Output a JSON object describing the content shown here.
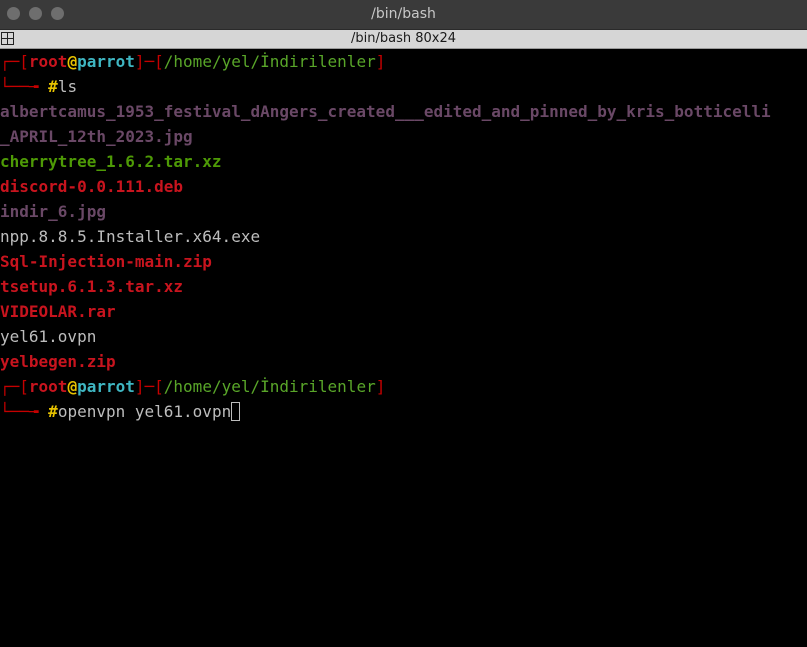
{
  "window": {
    "title": "/bin/bash",
    "tab_label": "/bin/bash 80x24"
  },
  "prompt1": {
    "corner_top": "┌─[",
    "user": "root",
    "at": "@",
    "host": "parrot",
    "sep": "]─[",
    "path": "/home/yel/İndirilenler",
    "close": "]",
    "corner_bottom": "└──╼ ",
    "hash": "#",
    "command": "ls"
  },
  "files": [
    {
      "name": "albertcamus_1953_festival_dAngers_created___edited_and_pinned_by_kris_botticelli",
      "kind": "image"
    },
    {
      "name": "_APRIL_12th_2023.jpg",
      "kind": "image"
    },
    {
      "name": "cherrytree_1.6.2.tar.xz",
      "kind": "archive-green"
    },
    {
      "name": "discord-0.0.111.deb",
      "kind": "archive-red"
    },
    {
      "name": "indir_6.jpg",
      "kind": "image"
    },
    {
      "name": "npp.8.8.5.Installer.x64.exe",
      "kind": "plain"
    },
    {
      "name": "Sql-Injection-main.zip",
      "kind": "archive-red"
    },
    {
      "name": "tsetup.6.1.3.tar.xz",
      "kind": "archive-red"
    },
    {
      "name": "VIDEOLAR.rar",
      "kind": "archive-red"
    },
    {
      "name": "yel61.ovpn",
      "kind": "plain"
    },
    {
      "name": "yelbegen.zip",
      "kind": "archive-red"
    }
  ],
  "prompt2": {
    "corner_top": "┌─[",
    "user": "root",
    "at": "@",
    "host": "parrot",
    "sep": "]─[",
    "path": "/home/yel/İndirilenler",
    "close": "]",
    "corner_bottom": "└──╼ ",
    "hash": "#",
    "command": "openvpn yel61.ovpn"
  },
  "colors": {
    "background": "#000000",
    "prompt_frame": "#c50000",
    "user": "#e8c300",
    "host": "#3fb6c2",
    "path": "#59a629",
    "image_file": "#6a4866",
    "archive_red": "#c8141e",
    "archive_green": "#4e9a06",
    "plain_text": "#bdbdbd"
  }
}
